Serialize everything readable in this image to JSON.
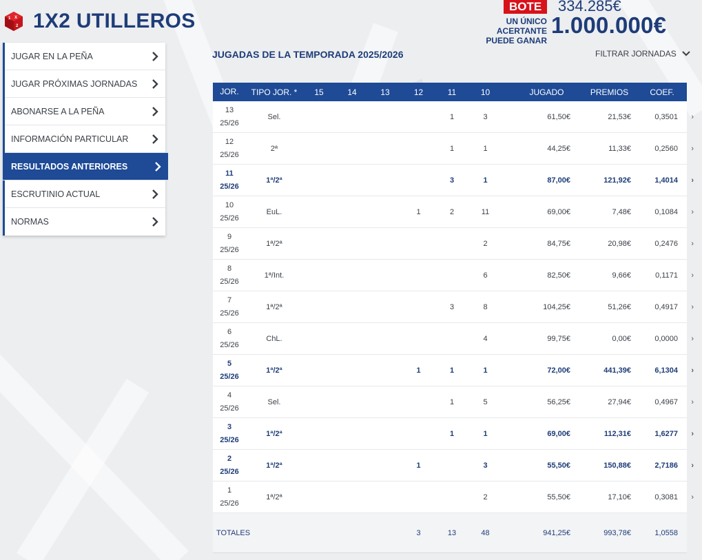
{
  "brand": {
    "title": "1X2 UTILLEROS",
    "logo_letters": "1X2"
  },
  "bote": {
    "badge": "BOTE",
    "amount": "334.285€",
    "note_line1": "UN ÚNICO ACERTANTE",
    "note_line2": "PUEDE GANAR",
    "prize": "1.000.000€"
  },
  "sidebar": {
    "items": [
      {
        "label": "JUGAR EN LA PEÑA"
      },
      {
        "label": "JUGAR PRÓXIMAS JORNADAS"
      },
      {
        "label": "ABONARSE A LA PEÑA"
      },
      {
        "label": "INFORMACIÓN PARTICULAR"
      },
      {
        "label": "RESULTADOS ANTERIORES",
        "active": true
      },
      {
        "label": "ESCRUTINIO ACTUAL"
      },
      {
        "label": "NORMAS"
      }
    ]
  },
  "main": {
    "title": "JUGADAS DE LA TEMPORADA 2025/2026",
    "filter_label": "FILTRAR JORNADAS"
  },
  "table": {
    "headers": [
      "JOR.",
      "TIPO JOR. *",
      "15",
      "14",
      "13",
      "12",
      "11",
      "10",
      "JUGADO",
      "PREMIOS",
      "COEF."
    ],
    "rows": [
      {
        "jor": "13",
        "season": "25/26",
        "tipo": "Sel.",
        "c15": "",
        "c14": "",
        "c13": "",
        "c12": "",
        "c11": "1",
        "c10": "3",
        "jugado": "61,50€",
        "premios": "21,53€",
        "coef": "0,3501",
        "bold": false
      },
      {
        "jor": "12",
        "season": "25/26",
        "tipo": "2ª",
        "c15": "",
        "c14": "",
        "c13": "",
        "c12": "",
        "c11": "1",
        "c10": "1",
        "jugado": "44,25€",
        "premios": "11,33€",
        "coef": "0,2560",
        "bold": false
      },
      {
        "jor": "11",
        "season": "25/26",
        "tipo": "1ª/2ª",
        "c15": "",
        "c14": "",
        "c13": "",
        "c12": "",
        "c11": "3",
        "c10": "1",
        "jugado": "87,00€",
        "premios": "121,92€",
        "coef": "1,4014",
        "bold": true
      },
      {
        "jor": "10",
        "season": "25/26",
        "tipo": "EuL.",
        "c15": "",
        "c14": "",
        "c13": "",
        "c12": "1",
        "c11": "2",
        "c10": "11",
        "jugado": "69,00€",
        "premios": "7,48€",
        "coef": "0,1084",
        "bold": false
      },
      {
        "jor": "9",
        "season": "25/26",
        "tipo": "1ª/2ª",
        "c15": "",
        "c14": "",
        "c13": "",
        "c12": "",
        "c11": "",
        "c10": "2",
        "jugado": "84,75€",
        "premios": "20,98€",
        "coef": "0,2476",
        "bold": false
      },
      {
        "jor": "8",
        "season": "25/26",
        "tipo": "1ª/Int.",
        "c15": "",
        "c14": "",
        "c13": "",
        "c12": "",
        "c11": "",
        "c10": "6",
        "jugado": "82,50€",
        "premios": "9,66€",
        "coef": "0,1171",
        "bold": false
      },
      {
        "jor": "7",
        "season": "25/26",
        "tipo": "1ª/2ª",
        "c15": "",
        "c14": "",
        "c13": "",
        "c12": "",
        "c11": "3",
        "c10": "8",
        "jugado": "104,25€",
        "premios": "51,26€",
        "coef": "0,4917",
        "bold": false
      },
      {
        "jor": "6",
        "season": "25/26",
        "tipo": "ChL.",
        "c15": "",
        "c14": "",
        "c13": "",
        "c12": "",
        "c11": "",
        "c10": "4",
        "jugado": "99,75€",
        "premios": "0,00€",
        "coef": "0,0000",
        "bold": false
      },
      {
        "jor": "5",
        "season": "25/26",
        "tipo": "1ª/2ª",
        "c15": "",
        "c14": "",
        "c13": "",
        "c12": "1",
        "c11": "1",
        "c10": "1",
        "jugado": "72,00€",
        "premios": "441,39€",
        "coef": "6,1304",
        "bold": true
      },
      {
        "jor": "4",
        "season": "25/26",
        "tipo": "Sel.",
        "c15": "",
        "c14": "",
        "c13": "",
        "c12": "",
        "c11": "1",
        "c10": "5",
        "jugado": "56,25€",
        "premios": "27,94€",
        "coef": "0,4967",
        "bold": false
      },
      {
        "jor": "3",
        "season": "25/26",
        "tipo": "1ª/2ª",
        "c15": "",
        "c14": "",
        "c13": "",
        "c12": "",
        "c11": "1",
        "c10": "1",
        "jugado": "69,00€",
        "premios": "112,31€",
        "coef": "1,6277",
        "bold": true
      },
      {
        "jor": "2",
        "season": "25/26",
        "tipo": "1ª/2ª",
        "c15": "",
        "c14": "",
        "c13": "",
        "c12": "1",
        "c11": "",
        "c10": "3",
        "jugado": "55,50€",
        "premios": "150,88€",
        "coef": "2,7186",
        "bold": true
      },
      {
        "jor": "1",
        "season": "25/26",
        "tipo": "1ª/2ª",
        "c15": "",
        "c14": "",
        "c13": "",
        "c12": "",
        "c11": "",
        "c10": "2",
        "jugado": "55,50€",
        "premios": "17,10€",
        "coef": "0,3081",
        "bold": false
      }
    ],
    "totals": {
      "label": "TOTALES",
      "c15": "",
      "c14": "",
      "c13": "",
      "c12": "3",
      "c11": "13",
      "c10": "48",
      "jugado": "941,25€",
      "premios": "993,78€",
      "coef": "1,0558"
    },
    "row_arrow": "›"
  },
  "colors": {
    "brand_blue": "#1e3c78",
    "accent_blue": "#1e4a96",
    "bote_red": "#d7121b",
    "background": "#eceef0"
  },
  "icons": {
    "logo": "dice-logo-icon",
    "chevron": "chevron-right-icon",
    "filter": "chevron-down-icon"
  }
}
